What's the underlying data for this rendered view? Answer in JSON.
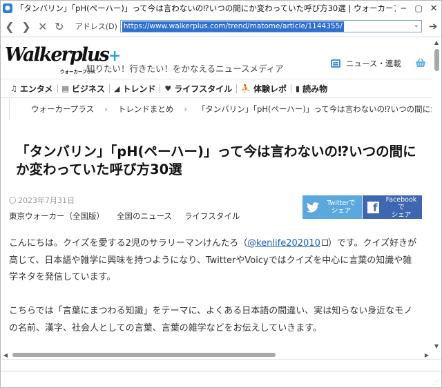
{
  "window": {
    "title": "「タンバリン」「pH(ペーハー)」って今は言わないの⁉いつの間にか変わっていた呼び方30選 | ウォーカープラス",
    "app_icon": "chat-bubble-icon",
    "minimize_label": "─",
    "restore_label": "▢",
    "close_label": "✕"
  },
  "toolbar": {
    "back_label": "❮",
    "forward_label": "❯",
    "stop_label": "✕",
    "refresh_label": "↻",
    "address_label": "アドレス(D)",
    "url": "https://www.walkerplus.com/trend/matome/article/1144355/",
    "dropdown_label": "⌄",
    "go_label": "➔"
  },
  "site": {
    "logo_text": "Walkerplus",
    "logo_plus": "+",
    "logo_sub": "ウォーカープラス",
    "tagline": "知りたい！行きたい！をかなえるニュースメディア",
    "news_link": "ニュース・連載",
    "categories": [
      {
        "icon": "♫",
        "label": "エンタメ"
      },
      {
        "icon": "▤",
        "label": "ビジネス"
      },
      {
        "icon": "◢",
        "label": "トレンド"
      },
      {
        "icon": "♥",
        "label": "ライフスタイル"
      },
      {
        "icon": "⛹",
        "label": "体験レポ"
      },
      {
        "icon": "▮",
        "label": "読み物"
      }
    ],
    "breadcrumb": [
      "ウォーカープラス",
      "トレンドまとめ",
      "「タンバリン」「pH(ペーハー)」って今は言わないの⁉いつの間にか変わっていた呼び方30選"
    ],
    "breadcrumb_sep": "›"
  },
  "article": {
    "title": "「タンバリン」「pH(ペーハー)」って今は言わないの⁉いつの間にか変わっていた呼び方30選",
    "date": "2023年7月31日",
    "tags": [
      "東京ウォーカー（全国版）",
      "全国のニュース",
      "ライフスタイル"
    ],
    "share_twitter": "Twitterで\nシェア",
    "share_facebook": "Facebookで\nシェア",
    "para1_a": "こんにちは。クイズを愛する2児のサラリーマンけんたろ（",
    "para1_link": "@kenlife202010",
    "para1_b": "）です。クイズ好きが高じて、日本語や雑学に興味を持つようになり、TwitterやVoicyではクイズを中心に言葉の知識や雑学ネタを発信しています。",
    "para2": "こちらでは「言葉にまつわる知識」をテーマに、よくある日本語の間違い、実は知らない身近なモノの名前、漢字、社会人としての言葉、言葉の雑学などをお伝えしていきます。"
  },
  "scrollbars": {
    "up": "▲",
    "down": "▼",
    "left": "◀",
    "right": "▶"
  }
}
